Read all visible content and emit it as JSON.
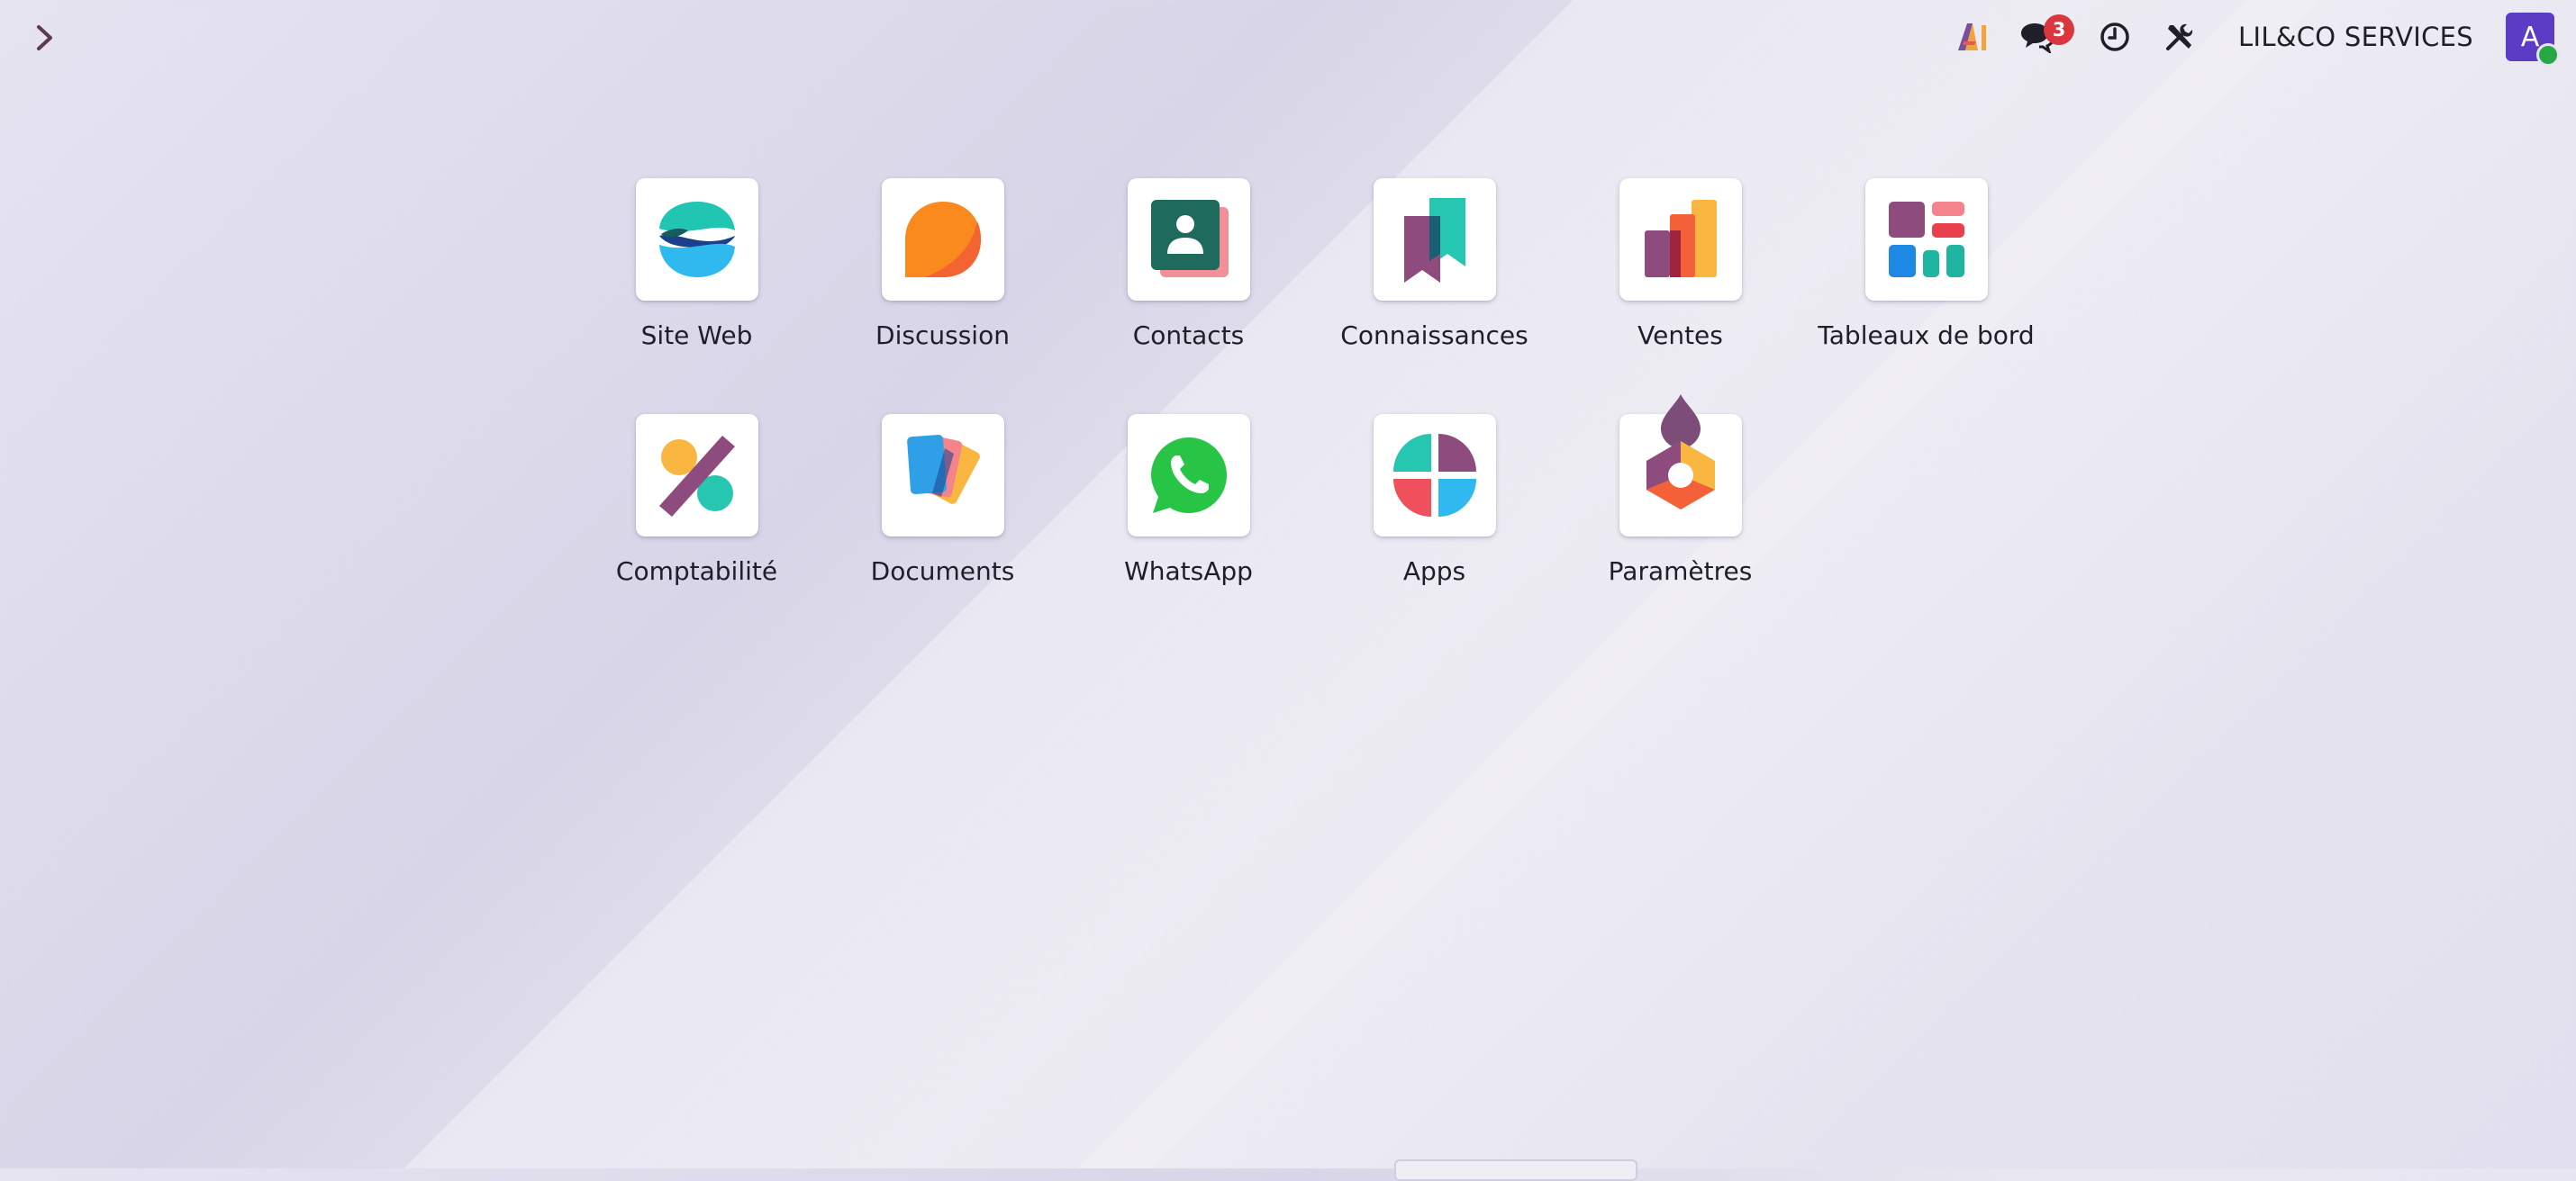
{
  "topbar": {
    "company": "LIL&CO SERVICES",
    "messages_count": "3",
    "avatar_initial": "A",
    "icons": [
      "sidebar-toggle-chevron-icon",
      "ai-icon",
      "chat-icon",
      "clock-icon",
      "tools-icon"
    ]
  },
  "apps": [
    {
      "label": "Site Web",
      "icon": "website-icon"
    },
    {
      "label": "Discussion",
      "icon": "discussion-icon"
    },
    {
      "label": "Contacts",
      "icon": "contacts-icon"
    },
    {
      "label": "Connaissances",
      "icon": "knowledge-icon"
    },
    {
      "label": "Ventes",
      "icon": "sales-icon"
    },
    {
      "label": "Tableaux de bord",
      "icon": "dashboards-icon"
    },
    {
      "label": "Comptabilité",
      "icon": "accounting-icon"
    },
    {
      "label": "Documents",
      "icon": "documents-icon"
    },
    {
      "label": "WhatsApp",
      "icon": "whatsapp-icon"
    },
    {
      "label": "Apps",
      "icon": "apps-icon"
    },
    {
      "label": "Paramètres",
      "icon": "settings-icon"
    }
  ],
  "colors": {
    "avatar": "#5b3cc4",
    "badge": "#d9363e",
    "status_online": "#28a745"
  }
}
